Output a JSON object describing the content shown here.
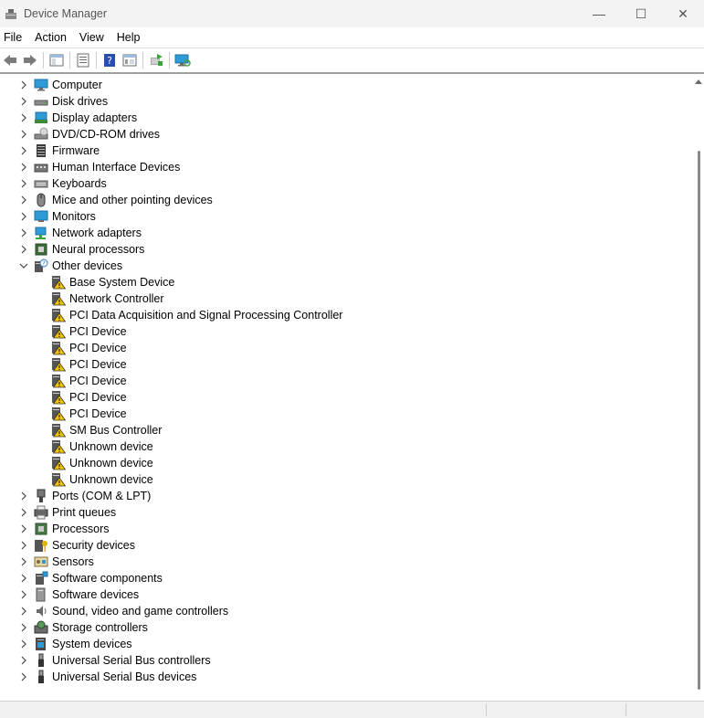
{
  "window": {
    "title": "Device Manager",
    "minimize_glyph": "—",
    "maximize_glyph": "☐",
    "close_glyph": "✕"
  },
  "menu": [
    "File",
    "Action",
    "View",
    "Help"
  ],
  "toolbar": {
    "buttons": [
      {
        "name": "back-icon"
      },
      {
        "name": "forward-icon"
      },
      {
        "sep": true
      },
      {
        "name": "show-hide-console-tree-icon"
      },
      {
        "sep": true
      },
      {
        "name": "properties-icon"
      },
      {
        "sep": true
      },
      {
        "name": "help-icon"
      },
      {
        "name": "view-icon"
      },
      {
        "sep": true
      },
      {
        "name": "update-driver-icon"
      },
      {
        "sep": true
      },
      {
        "name": "scan-hardware-icon"
      }
    ]
  },
  "tree": {
    "categories": [
      {
        "label": "Computer",
        "icon": "computer-icon",
        "expanded": false
      },
      {
        "label": "Disk drives",
        "icon": "disk-drive-icon",
        "expanded": false
      },
      {
        "label": "Display adapters",
        "icon": "display-adapter-icon",
        "expanded": false
      },
      {
        "label": "DVD/CD-ROM drives",
        "icon": "dvd-drive-icon",
        "expanded": false
      },
      {
        "label": "Firmware",
        "icon": "firmware-icon",
        "expanded": false
      },
      {
        "label": "Human Interface Devices",
        "icon": "hid-icon",
        "expanded": false
      },
      {
        "label": "Keyboards",
        "icon": "keyboard-icon",
        "expanded": false
      },
      {
        "label": "Mice and other pointing devices",
        "icon": "mouse-icon",
        "expanded": false
      },
      {
        "label": "Monitors",
        "icon": "monitor-icon",
        "expanded": false
      },
      {
        "label": "Network adapters",
        "icon": "network-adapter-icon",
        "expanded": false
      },
      {
        "label": "Neural processors",
        "icon": "neural-processor-icon",
        "expanded": false
      },
      {
        "label": "Other devices",
        "icon": "other-devices-icon",
        "expanded": true,
        "children": [
          "Base System Device",
          "Network Controller",
          "PCI Data Acquisition and Signal Processing Controller",
          "PCI Device",
          "PCI Device",
          "PCI Device",
          "PCI Device",
          "PCI Device",
          "PCI Device",
          "SM Bus Controller",
          "Unknown device",
          "Unknown device",
          "Unknown device"
        ]
      },
      {
        "label": "Ports (COM & LPT)",
        "icon": "port-icon",
        "expanded": false
      },
      {
        "label": "Print queues",
        "icon": "printer-icon",
        "expanded": false
      },
      {
        "label": "Processors",
        "icon": "processor-icon",
        "expanded": false
      },
      {
        "label": "Security devices",
        "icon": "security-device-icon",
        "expanded": false
      },
      {
        "label": "Sensors",
        "icon": "sensor-icon",
        "expanded": false
      },
      {
        "label": "Software components",
        "icon": "software-component-icon",
        "expanded": false
      },
      {
        "label": "Software devices",
        "icon": "software-device-icon",
        "expanded": false
      },
      {
        "label": "Sound, video and game controllers",
        "icon": "speaker-icon",
        "expanded": false
      },
      {
        "label": "Storage controllers",
        "icon": "storage-controller-icon",
        "expanded": false
      },
      {
        "label": "System devices",
        "icon": "system-device-icon",
        "expanded": false
      },
      {
        "label": "Universal Serial Bus controllers",
        "icon": "usb-icon",
        "expanded": false
      },
      {
        "label": "Universal Serial Bus devices",
        "icon": "usb-icon",
        "expanded": false
      }
    ]
  },
  "colors": {
    "accent": "#2b78d4",
    "warning": "#f5c400",
    "monitor_blue": "#2e9bd6"
  }
}
